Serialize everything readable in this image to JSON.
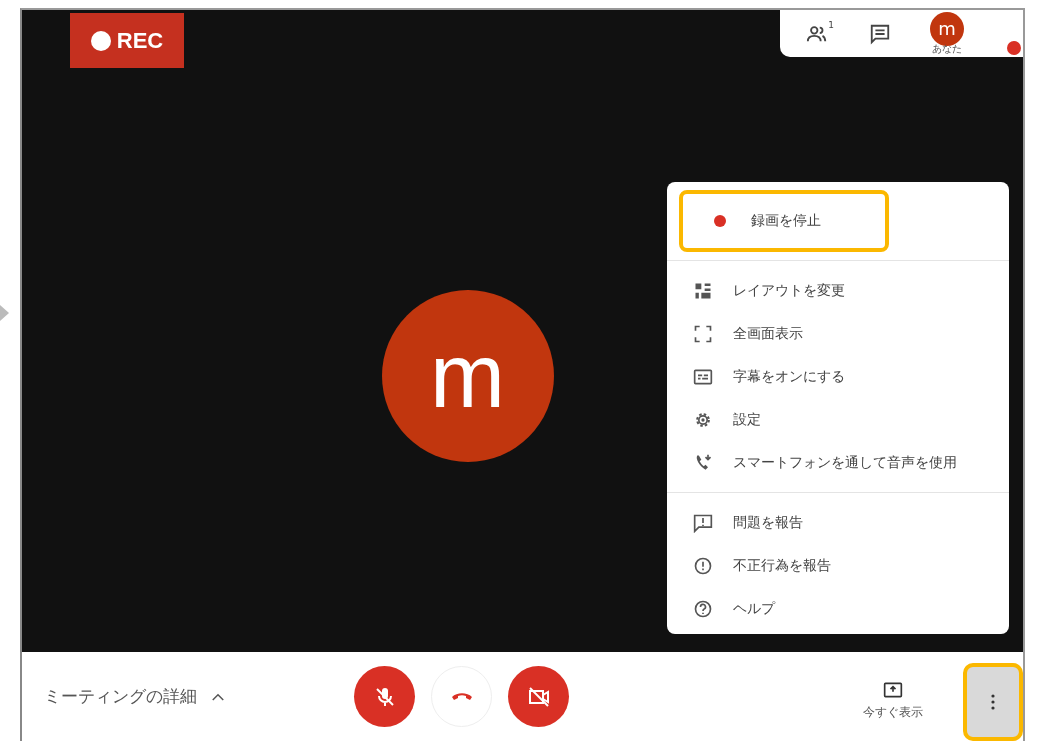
{
  "recording_badge": {
    "label": "REC"
  },
  "top_panel": {
    "participants_count": "1",
    "avatar_letter": "m",
    "avatar_caption": "あなた"
  },
  "main_avatar": {
    "letter": "m"
  },
  "menu": {
    "groups": [
      [
        {
          "kind": "record",
          "label": "録画を停止",
          "highlighted": true
        }
      ],
      [
        {
          "kind": "layout",
          "label": "レイアウトを変更",
          "highlighted": false
        },
        {
          "kind": "fullscreen",
          "label": "全画面表示",
          "highlighted": false
        },
        {
          "kind": "captions",
          "label": "字幕をオンにする",
          "highlighted": false
        },
        {
          "kind": "settings",
          "label": "設定",
          "highlighted": false
        },
        {
          "kind": "phone",
          "label": "スマートフォンを通して音声を使用",
          "highlighted": false
        }
      ],
      [
        {
          "kind": "report",
          "label": "問題を報告",
          "highlighted": false
        },
        {
          "kind": "abuse",
          "label": "不正行為を報告",
          "highlighted": false
        },
        {
          "kind": "help",
          "label": "ヘルプ",
          "highlighted": false
        }
      ]
    ]
  },
  "bottom_bar": {
    "details_label": "ミーティングの詳細",
    "controls": [
      {
        "kind": "mic",
        "off": true
      },
      {
        "kind": "hangup",
        "off": false
      },
      {
        "kind": "camera",
        "off": true
      }
    ],
    "present_label": "今すぐ表示",
    "more_highlighted": true
  }
}
